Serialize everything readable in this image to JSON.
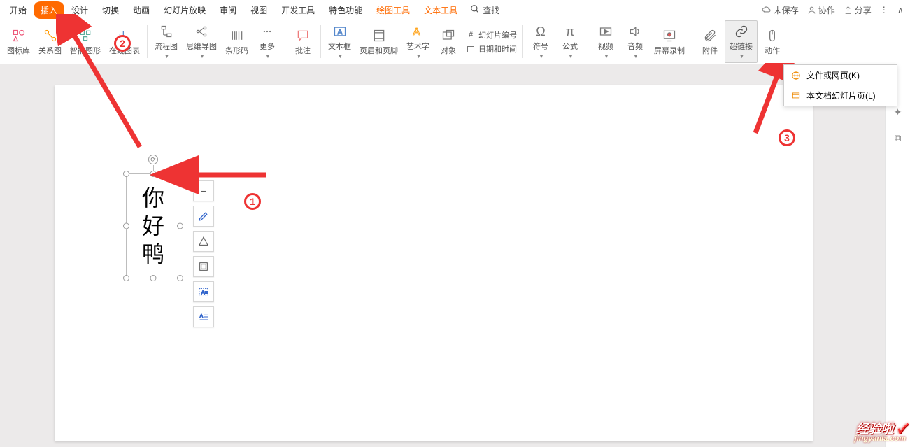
{
  "tabs": {
    "items": [
      "开始",
      "插入",
      "设计",
      "切换",
      "动画",
      "幻灯片放映",
      "审阅",
      "视图",
      "开发工具",
      "特色功能"
    ],
    "tool": [
      "绘图工具",
      "文本工具"
    ],
    "search": "查找",
    "active_index": 1
  },
  "topright": {
    "unsaved": "未保存",
    "coop": "协作",
    "share": "分享"
  },
  "ribbon": {
    "iconlib": "图标库",
    "relgraph": "关系图",
    "smart": "智能图形",
    "onlinechart": "在线图表",
    "flow": "流程图",
    "mind": "思维导图",
    "barcode": "条形码",
    "more": "更多",
    "annotate": "批注",
    "textbox": "文本框",
    "headerfooter": "页眉和页脚",
    "wordart": "艺术字",
    "object": "对象",
    "slidenum": "幻灯片编号",
    "datetime": "日期和时间",
    "symbol": "符号",
    "formula": "公式",
    "video": "视频",
    "audio": "音频",
    "screenrec": "屏幕录制",
    "attachment": "附件",
    "hyperlink": "超链接",
    "action": "动作"
  },
  "dropdown": {
    "file": "文件或网页(K)",
    "slide": "本文档幻灯片页(L)"
  },
  "slide_text": [
    "你",
    "好",
    "鸭"
  ],
  "annotations": {
    "n1": "1",
    "n2": "2",
    "n3": "3"
  },
  "watermark": {
    "main": "经验啦",
    "check": "✓",
    "sub": "jingyanla.com"
  }
}
